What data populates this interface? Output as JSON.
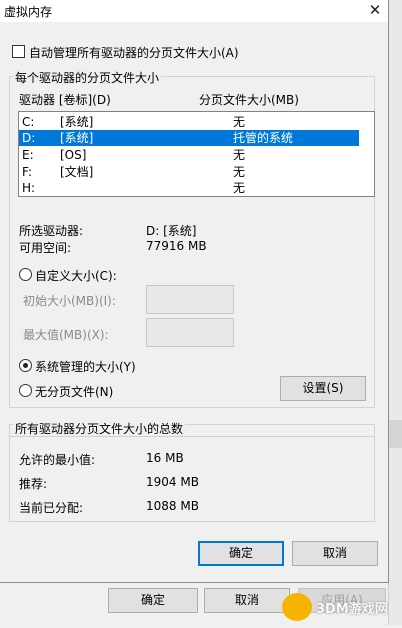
{
  "window": {
    "title": "虚拟内存",
    "close_glyph": "✕"
  },
  "auto_manage": {
    "label": "自动管理所有驱动器的分页文件大小(A)",
    "checked": false
  },
  "per_drive_group": {
    "title": "每个驱动器的分页文件大小",
    "col_drive": "驱动器 [卷标](D)",
    "col_size": "分页文件大小(MB)",
    "rows": [
      {
        "drive": "C:",
        "label": "[系统]",
        "size": "无",
        "selected": false
      },
      {
        "drive": "D:",
        "label": "[系统]",
        "size": "托管的系统",
        "selected": true
      },
      {
        "drive": "E:",
        "label": "[OS]",
        "size": "无",
        "selected": false
      },
      {
        "drive": "F:",
        "label": "[文档]",
        "size": "无",
        "selected": false
      },
      {
        "drive": "H:",
        "label": "",
        "size": "无",
        "selected": false
      }
    ],
    "selected_drive_label": "所选驱动器:",
    "selected_drive_value": "D:  [系统]",
    "free_space_label": "可用空间:",
    "free_space_value": "77916 MB",
    "custom_size": {
      "label": "自定义大小(C):",
      "selected": false
    },
    "initial_size_label": "初始大小(MB)(I):",
    "initial_size_value": "",
    "max_size_label": "最大值(MB)(X):",
    "max_size_value": "",
    "system_managed": {
      "label": "系统管理的大小(Y)",
      "selected": true
    },
    "no_paging": {
      "label": "无分页文件(N)",
      "selected": false
    },
    "set_button": "设置(S)"
  },
  "totals_group": {
    "title": "所有驱动器分页文件大小的总数",
    "min_label": "允许的最小值:",
    "min_value": "16 MB",
    "recommended_label": "推荐:",
    "recommended_value": "1904 MB",
    "allocated_label": "当前已分配:",
    "allocated_value": "1088 MB"
  },
  "dialog_buttons": {
    "ok": "确定",
    "cancel": "取消"
  },
  "parent_buttons": {
    "ok": "确定",
    "cancel": "取消",
    "apply": "应用(A)"
  },
  "watermark": "3DM游戏网",
  "scroll": {
    "up": "▲",
    "down": "▼"
  }
}
